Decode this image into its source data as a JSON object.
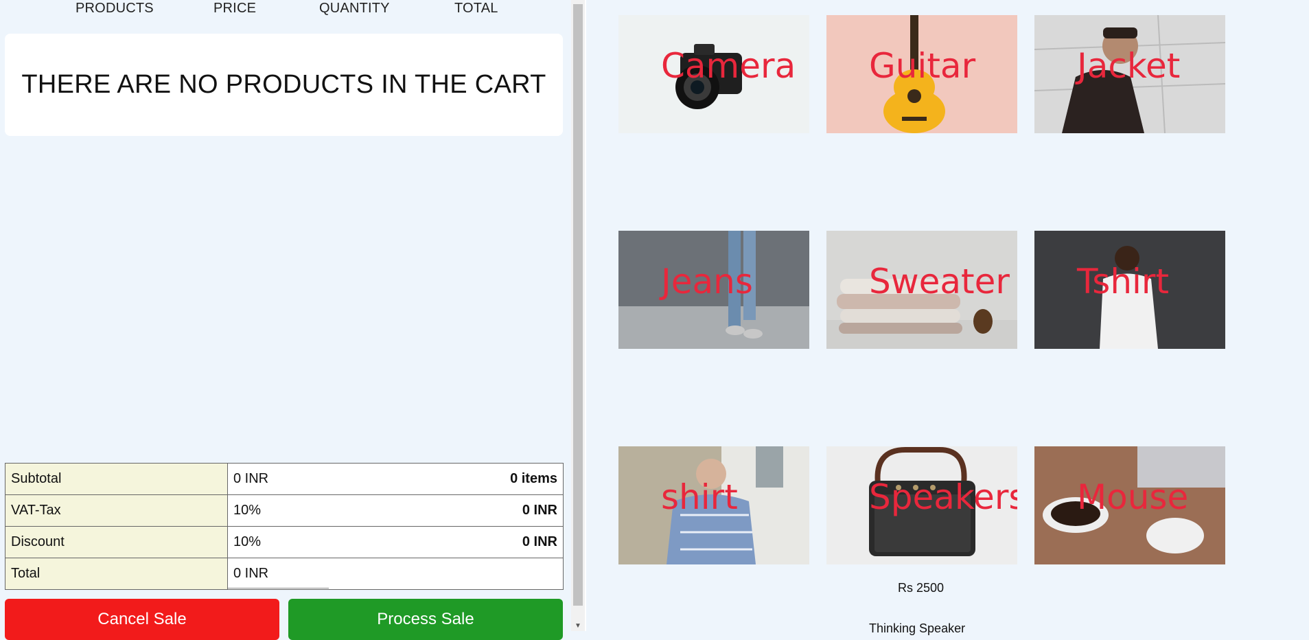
{
  "cart": {
    "columns": [
      "PRODUCTS",
      "PRICE",
      "QUANTITY",
      "TOTAL"
    ],
    "empty_message": "THERE ARE NO PRODUCTS IN THE CART"
  },
  "summary": {
    "rows": [
      {
        "label": "Subtotal",
        "value": "0 INR",
        "extra": "0 items"
      },
      {
        "label": "VAT-Tax",
        "value": "10%",
        "extra": "0 INR"
      },
      {
        "label": "Discount",
        "value": "10%",
        "extra": "0 INR"
      },
      {
        "label": "Total",
        "value": "0 INR",
        "extra": ""
      }
    ]
  },
  "actions": {
    "cancel_label": "Cancel Sale",
    "process_label": "Process Sale"
  },
  "products": [
    {
      "name": "Camera"
    },
    {
      "name": "Guitar"
    },
    {
      "name": "Jacket"
    },
    {
      "name": "Jeans"
    },
    {
      "name": "Sweater"
    },
    {
      "name": "Tshirt"
    },
    {
      "name": "shirt"
    },
    {
      "name": "Speakers"
    },
    {
      "name": "Mouse"
    }
  ],
  "featured": {
    "price": "Rs 2500",
    "partial_text": "Thinking Speaker"
  },
  "colors": {
    "cancel": "#f21b1b",
    "process": "#1f9a26",
    "label_bg": "#f5f5dc",
    "product_text": "#e8273c",
    "page_bg": "#eef5fc"
  }
}
